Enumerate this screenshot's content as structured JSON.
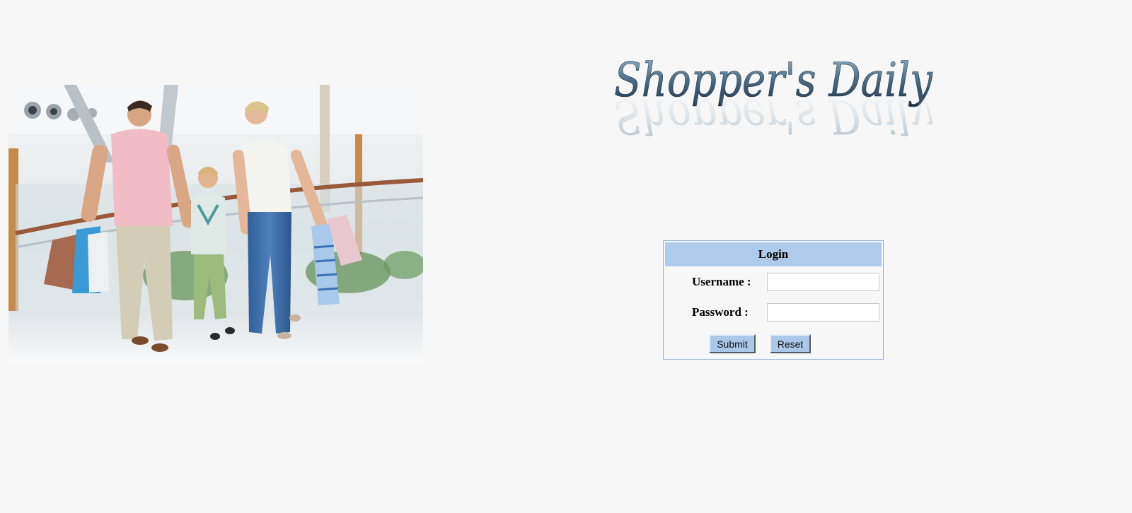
{
  "header": {
    "logo_text": "Shopper's Daily"
  },
  "hero": {
    "image_description": "family-shopping-photo"
  },
  "login": {
    "title": "Login",
    "username_label": "Username :",
    "password_label": "Password :",
    "username_value": "",
    "password_value": "",
    "submit_label": "Submit",
    "reset_label": "Reset"
  },
  "colors": {
    "page_bg": "#f7f7f7",
    "header_bg": "#aecbeb",
    "box_border": "#8fb6d9",
    "button_bg": "#a9c8ea"
  }
}
